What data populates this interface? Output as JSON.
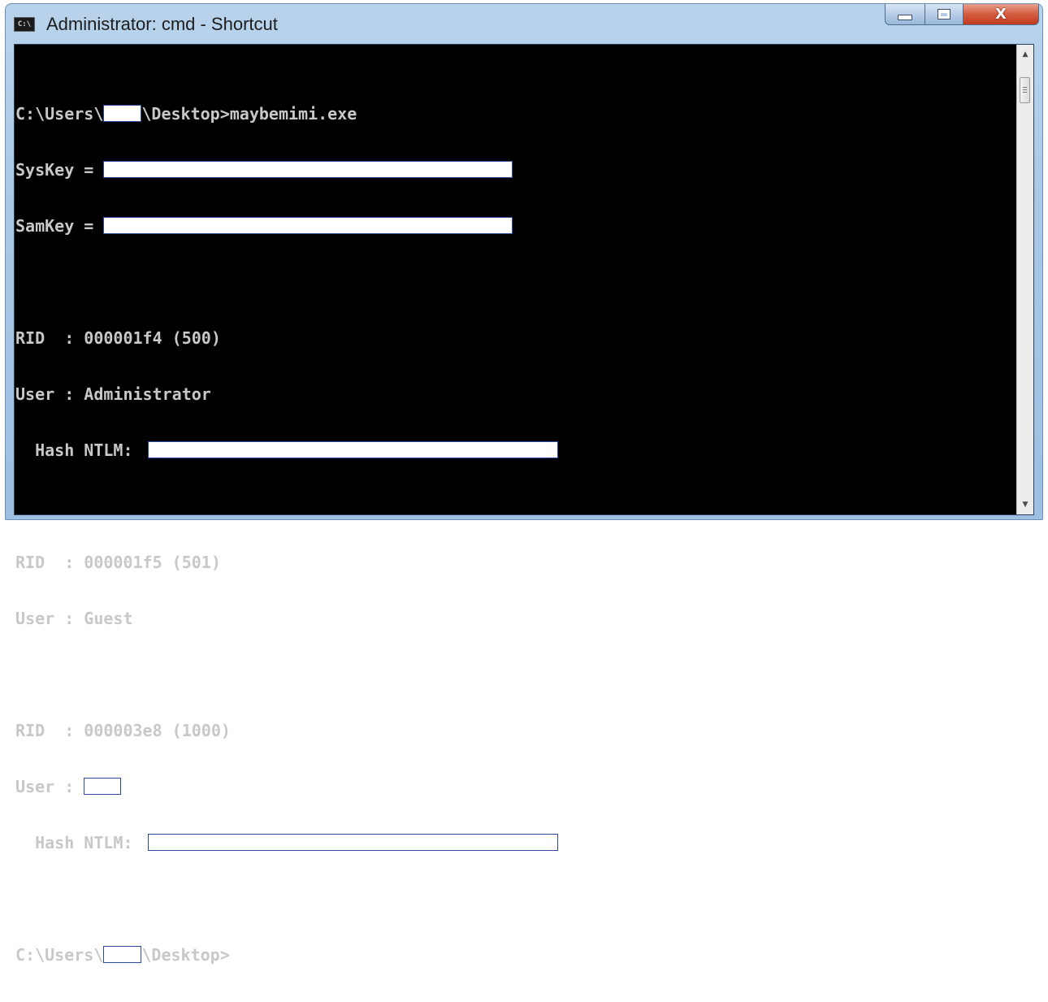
{
  "window": {
    "title": "Administrator: cmd - Shortcut",
    "icon": "cmd-icon",
    "icon_text": "C:\\",
    "controls": {
      "minimize": "minimize-icon",
      "maximize": "maximize-icon",
      "close_label": "X"
    }
  },
  "console": {
    "line1_pre": "C:\\Users\\",
    "line1_post": "\\Desktop>maybemimi.exe",
    "syskey_label": "SysKey = ",
    "samkey_label": "SamKey = ",
    "block1": {
      "rid": "RID  : 000001f4 (500)",
      "user": "User : Administrator",
      "hash_label": "  Hash NTLM: "
    },
    "block2": {
      "rid": "RID  : 000001f5 (501)",
      "user": "User : Guest"
    },
    "block3": {
      "rid": "RID  : 000003e8 (1000)",
      "user_label": "User : ",
      "hash_label": "  Hash NTLM: "
    },
    "prompt_pre": "C:\\Users\\",
    "prompt_post": "\\Desktop>"
  },
  "scrollbar": {
    "up": "▲",
    "down": "▼"
  },
  "colors": {
    "console_bg": "#000000",
    "console_text": "#c8c8c8",
    "title_bar": "#a9c8e6",
    "close_button": "#c23b1e"
  }
}
